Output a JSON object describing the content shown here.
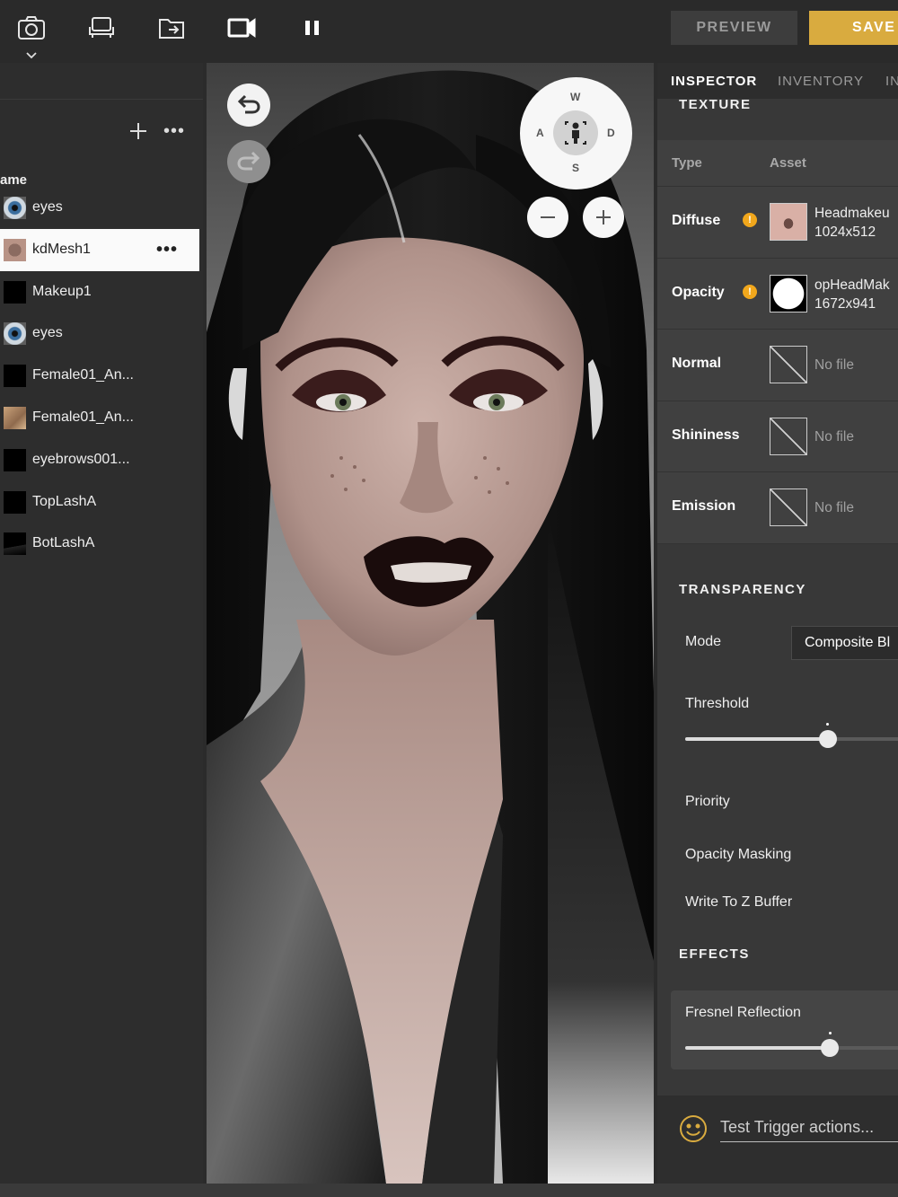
{
  "toolbar": {
    "icons": [
      "camera-icon",
      "furniture-icon",
      "export-folder-icon",
      "video-camera-icon",
      "pause-icon"
    ],
    "preview_label": "PREVIEW",
    "save_label": "SAVE",
    "accent_color": "#d9ab3f"
  },
  "left_panel": {
    "column_header": "ame",
    "layers": [
      {
        "name": "eyes",
        "thumb": "eye"
      },
      {
        "name": "kdMesh1",
        "thumb": "face",
        "selected": true
      },
      {
        "name": "Makeup1",
        "thumb": "black"
      },
      {
        "name": "eyes",
        "thumb": "eye"
      },
      {
        "name": "Female01_An...",
        "thumb": "black"
      },
      {
        "name": "Female01_An...",
        "thumb": "skin"
      },
      {
        "name": "eyebrows001...",
        "thumb": "black"
      },
      {
        "name": "TopLashA",
        "thumb": "black"
      },
      {
        "name": "BotLashA",
        "thumb": "bot"
      }
    ]
  },
  "viewport": {
    "nav": {
      "north": "W",
      "west": "A",
      "east": "D",
      "south": "S"
    }
  },
  "inspector": {
    "tabs": [
      {
        "label": "INSPECTOR",
        "active": true
      },
      {
        "label": "INVENTORY",
        "active": false
      },
      {
        "label": "IN",
        "active": false
      }
    ],
    "texture_header": "TEXTURE",
    "texture_table": {
      "col_type": "Type",
      "col_asset": "Asset",
      "rows": [
        {
          "type": "Diffuse",
          "warning": "!",
          "asset_line1": "Headmakeu",
          "asset_line2": "1024x512"
        },
        {
          "type": "Opacity",
          "warning": "!",
          "asset_line1": "opHeadMak",
          "asset_line2": "1672x941"
        },
        {
          "type": "Normal",
          "asset_line1": "No file"
        },
        {
          "type": "Shininess",
          "asset_line1": "No file"
        },
        {
          "type": "Emission",
          "asset_line1": "No file"
        }
      ]
    },
    "transparency": {
      "header": "TRANSPARENCY",
      "mode_label": "Mode",
      "mode_value": "Composite Bl",
      "threshold_label": "Threshold",
      "threshold_value": 0.61,
      "priority_label": "Priority",
      "opacity_masking_label": "Opacity Masking",
      "write_z_label": "Write To Z Buffer"
    },
    "effects": {
      "header": "EFFECTS",
      "fresnel_label": "Fresnel Reflection",
      "fresnel_value": 0.62
    },
    "trigger_placeholder": "Test Trigger actions..."
  }
}
